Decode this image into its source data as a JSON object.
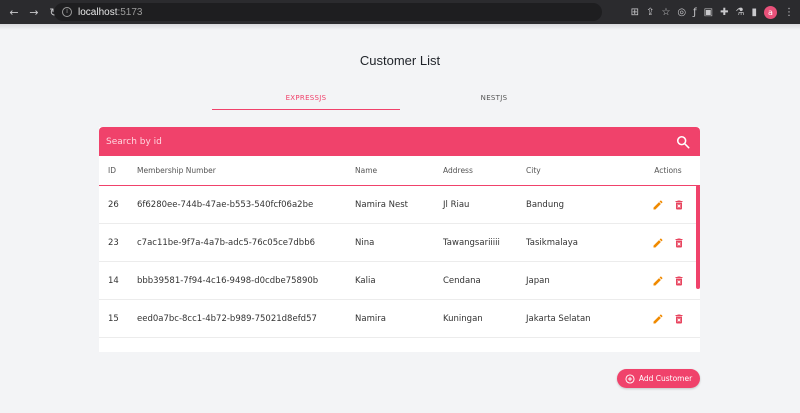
{
  "browser": {
    "url_host": "localhost",
    "url_port": ":5173",
    "profile_initial": "a"
  },
  "page": {
    "title": "Customer List"
  },
  "tabs": [
    {
      "label": "EXPRESSJS",
      "active": true
    },
    {
      "label": "NESTJS",
      "active": false
    }
  ],
  "search": {
    "placeholder": "Search by id",
    "icon": "search-icon"
  },
  "table": {
    "headers": [
      "ID",
      "Membership Number",
      "Name",
      "Address",
      "City",
      "Actions"
    ],
    "rows": [
      {
        "id": "26",
        "membership": "6f6280ee-744b-47ae-b553-540fcf06a2be",
        "name": "Namira Nest",
        "address": "Jl Riau",
        "city": "Bandung"
      },
      {
        "id": "23",
        "membership": "c7ac11be-9f7a-4a7b-adc5-76c05ce7dbb6",
        "name": "Nina",
        "address": "Tawangsariiiii",
        "city": "Tasikmalaya"
      },
      {
        "id": "14",
        "membership": "bbb39581-7f94-4c16-9498-d0cdbe75890b",
        "name": "Kalia",
        "address": "Cendana",
        "city": "Japan"
      },
      {
        "id": "15",
        "membership": "eed0a7bc-8cc1-4b72-b989-75021d8efd57",
        "name": "Namira",
        "address": "Kuningan",
        "city": "Jakarta Selatan"
      }
    ]
  },
  "add_button": {
    "label": "Add Customer"
  },
  "colors": {
    "accent": "#f0426b",
    "edit": "#f08a00",
    "delete": "#e8455f"
  }
}
